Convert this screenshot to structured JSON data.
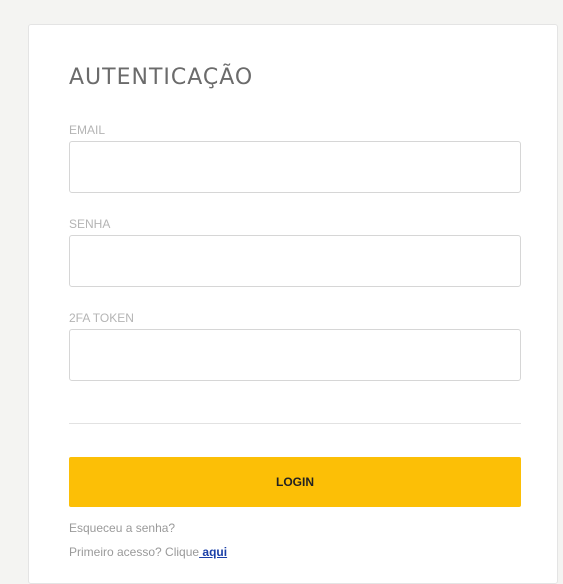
{
  "login": {
    "title": "AUTENTICAÇÃO",
    "email": {
      "label": "EMAIL",
      "value": ""
    },
    "password": {
      "label": "SENHA",
      "value": ""
    },
    "token": {
      "label": "2FA TOKEN",
      "value": ""
    },
    "submit_label": "LOGIN",
    "forgot_text": "Esqueceu a senha?",
    "first_access_prefix": "Primeiro acesso? Clique",
    "first_access_link": " aqui"
  },
  "colors": {
    "accent": "#fcbf06",
    "link": "#1a3fa8",
    "background": "#f4f4f2"
  }
}
